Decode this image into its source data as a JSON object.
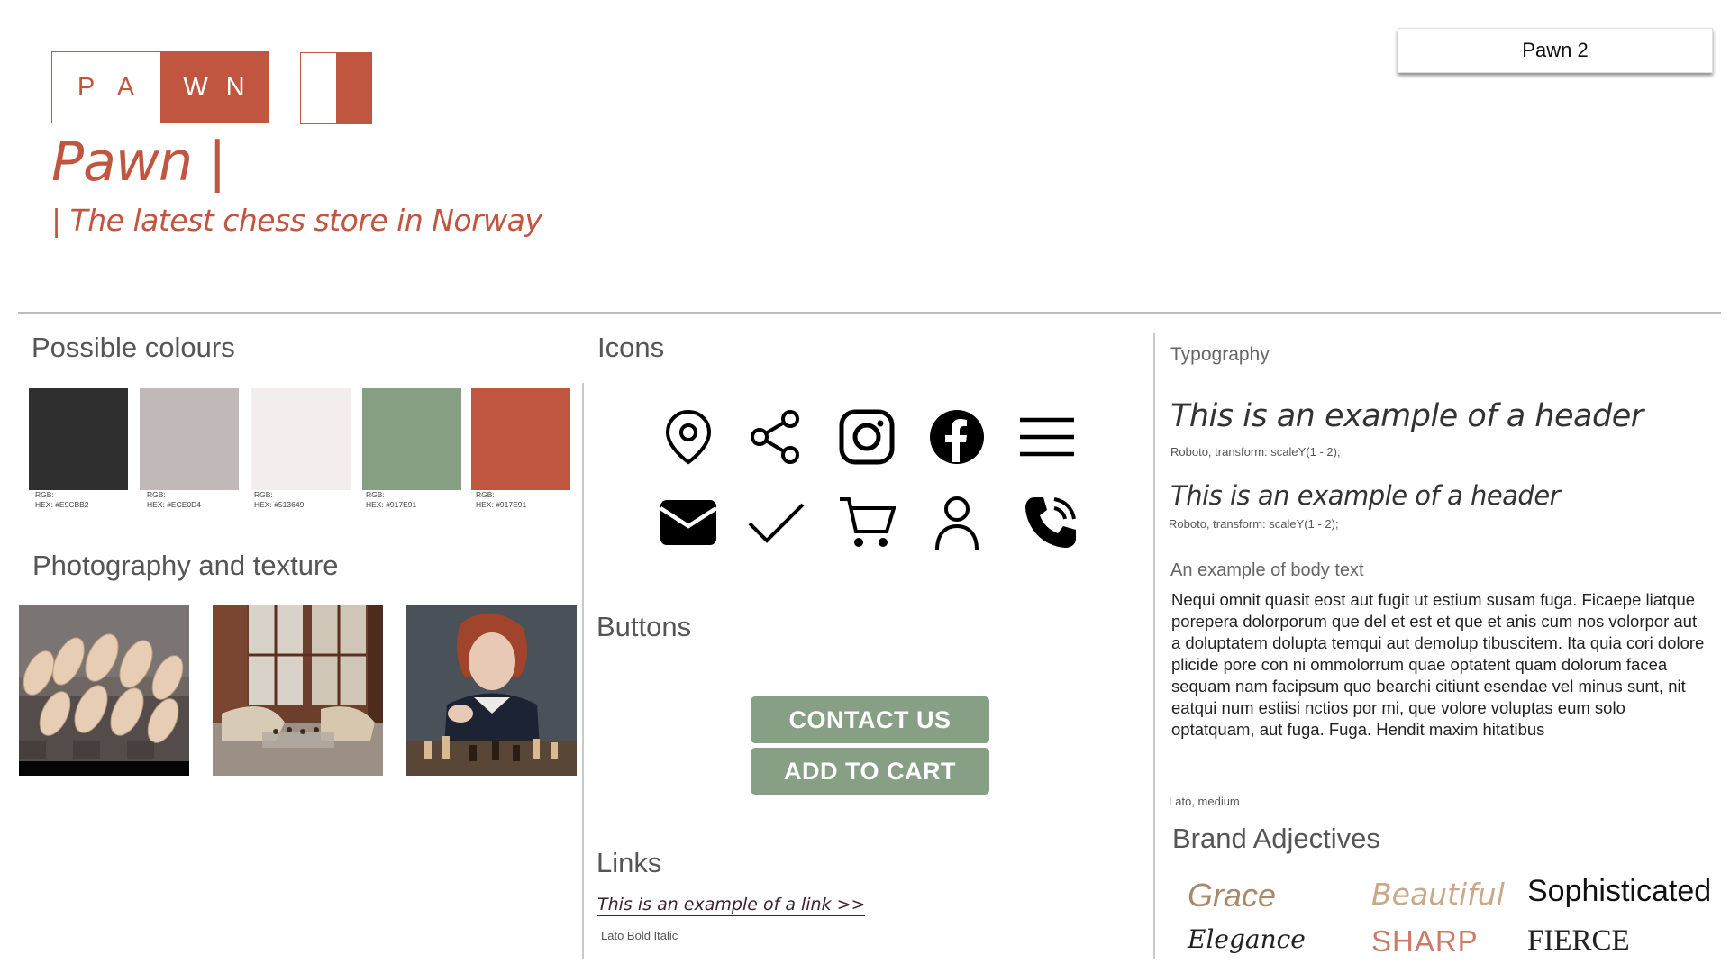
{
  "logo": {
    "letters_left": [
      "P",
      "A"
    ],
    "letters_right": [
      "W",
      "N"
    ]
  },
  "brand": {
    "title": "Pawn |",
    "tagline": "| The latest chess store in Norway"
  },
  "top_button": {
    "label": "Pawn 2"
  },
  "colours": {
    "title": "Possible colours",
    "swatches": [
      {
        "hex": "#2f2f2f",
        "rgb_label": "RGB:",
        "hex_label": "HEX: #E9CBB2"
      },
      {
        "hex": "#c1b9b8",
        "rgb_label": "RGB:",
        "hex_label": "HEX: #ECE0D4"
      },
      {
        "hex": "#f3eded",
        "rgb_label": "RGB:",
        "hex_label": "HEX: #513649"
      },
      {
        "hex": "#87a085",
        "rgb_label": "RGB:",
        "hex_label": "HEX: #917E91"
      },
      {
        "hex": "#c15640",
        "rgb_label": "RGB:",
        "hex_label": "HEX: #917E91"
      }
    ]
  },
  "photography": {
    "title": "Photography and texture"
  },
  "icons": {
    "title": "Icons",
    "items": [
      "location-pin-icon",
      "share-icon",
      "instagram-icon",
      "facebook-icon",
      "menu-icon",
      "mail-icon",
      "checkmark-icon",
      "cart-icon",
      "user-icon",
      "phone-icon"
    ]
  },
  "buttons": {
    "title": "Buttons",
    "contact_label": "CONTACT US",
    "cart_label": "ADD TO CART",
    "color": "#87a085"
  },
  "links": {
    "title": "Links",
    "sample": "This is an example of a link >>",
    "font_note": "Lato Bold Italic"
  },
  "typography": {
    "title": "Typography",
    "header1": "This is an example of a header",
    "header1_note": "Roboto, transform: scaleY(1 - 2);",
    "header2": "This is an example of a header",
    "header2_note": "Roboto, transform: scaleY(1 - 2);",
    "body_title": "An example of body text",
    "body_text": "Nequi omnit quasit eost aut fugit ut estium susam fuga. Ficaepe liatque porepera dolorporum que del et est et que et anis cum nos volorpor aut a doluptatem dolupta temqui aut demolup tibuscitem. Ita quia cori dolore plicide pore con ni ommolorrum quae optatent quam dolorum facea sequam nam facipsum quo bearchi citiunt esendae vel minus sunt, nit eatqui num estiisi nctios por mi, que volore voluptas eum solo optatquam, aut fuga. Fuga. Hendit maxim hitatibus",
    "body_note": "Lato, medium"
  },
  "adjectives": {
    "title": "Brand Adjectives",
    "items": [
      "Grace",
      "Beautiful",
      "Sophisticated",
      "Elegance",
      "SHARP",
      "FIERCE"
    ]
  },
  "accent_color": "#c15640"
}
